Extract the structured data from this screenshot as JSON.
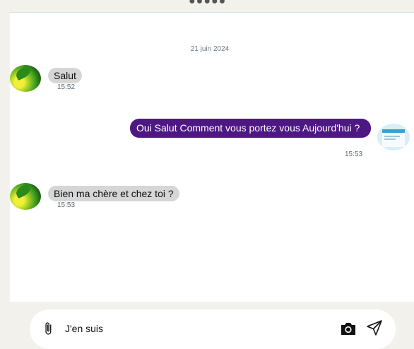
{
  "header": {
    "dots": "●●●●●"
  },
  "chat": {
    "date": "21 juin 2024",
    "messages": [
      {
        "direction": "incoming",
        "text": "Salut",
        "time": "15:52"
      },
      {
        "direction": "outgoing",
        "text": "Oui Salut Comment vous portez vous Aujourd'hui ?",
        "time": "15:53"
      },
      {
        "direction": "incoming",
        "text": "Bien ma chère et chez toi ?",
        "time": "15:53"
      }
    ]
  },
  "composer": {
    "value": "J'en suis",
    "icons": {
      "attach": "paperclip-icon",
      "camera": "camera-icon",
      "send": "send-icon"
    }
  },
  "colors": {
    "outgoing_bubble": "#4e1883",
    "incoming_bubble": "#d6d6d6",
    "background": "#f2f1ec"
  }
}
